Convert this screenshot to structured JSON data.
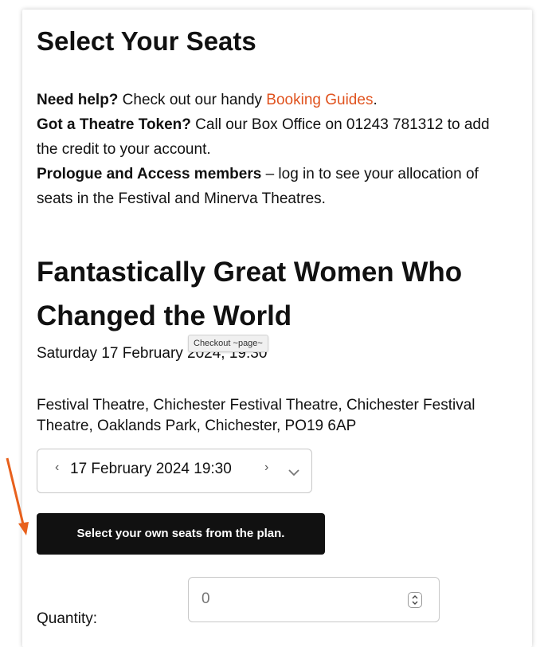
{
  "page": {
    "title": "Select Your Seats"
  },
  "help": {
    "need_help_bold": "Need help?",
    "need_help_text": " Check out our handy ",
    "booking_guides_link": "Booking Guides",
    "period": ".",
    "token_bold": "Got a Theatre Token?",
    "token_text": " Call our Box Office on 01243 781312 to add the credit to your account.",
    "members_bold": "Prologue and Access members",
    "members_text": " – log in to see your allocation of seats in the Festival and Minerva Theatres."
  },
  "show": {
    "title": "Fantastically Great Women Who Changed the World",
    "date_time": "Saturday 17 February 2024, 19:30",
    "venue": "Festival Theatre, Chichester Festival Theatre, Chichester Festival Theatre, Oaklands Park, Chichester, PO19 6AP"
  },
  "tooltip": {
    "text": "Checkout ~page~"
  },
  "performance_select": {
    "selected": "17 February 2024 19:30",
    "prev_icon": "chevron-left-icon",
    "next_icon": "chevron-right-icon",
    "dropdown_icon": "chevron-down-icon"
  },
  "plan_button": {
    "label": "Select your own seats from the plan."
  },
  "quantity": {
    "label": "Quantity:",
    "placeholder": "0"
  },
  "colors": {
    "link": "#e0531f",
    "button_bg": "#111111",
    "annotation_arrow": "#e8601c"
  }
}
